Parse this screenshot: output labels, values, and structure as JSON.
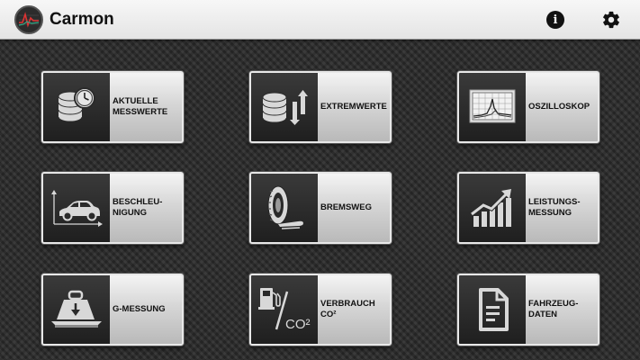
{
  "app": {
    "title": "Carmon"
  },
  "header": {
    "info_icon": "info-icon",
    "settings_icon": "gear-icon",
    "info_glyph": "i"
  },
  "tiles": [
    {
      "label": "AKTUELLE\nMESSWERTE",
      "icon": "database-clock-icon"
    },
    {
      "label": "EXTREMWERTE",
      "icon": "database-arrows-icon"
    },
    {
      "label": "OSZILLOSKOP",
      "icon": "oscilloscope-icon"
    },
    {
      "label": "BESCHLEU-\nNIGUNG",
      "icon": "car-acceleration-icon"
    },
    {
      "label": "BREMSWEG",
      "icon": "tire-icon"
    },
    {
      "label": "LEISTUNGS-\nMESSUNG",
      "icon": "bar-chart-arrow-icon"
    },
    {
      "label": "G-MESSUNG",
      "icon": "weight-icon"
    },
    {
      "label": "VERBRAUCH\nCO²",
      "icon": "fuel-co2-icon",
      "icon_text": "CO²"
    },
    {
      "label": "FAHRZEUG-\nDATEN",
      "icon": "document-icon"
    }
  ],
  "colors": {
    "appbar": "#eeeeee",
    "background": "#2b2b2b",
    "icon_box": "#2a2a2a",
    "label_text": "#111111"
  }
}
